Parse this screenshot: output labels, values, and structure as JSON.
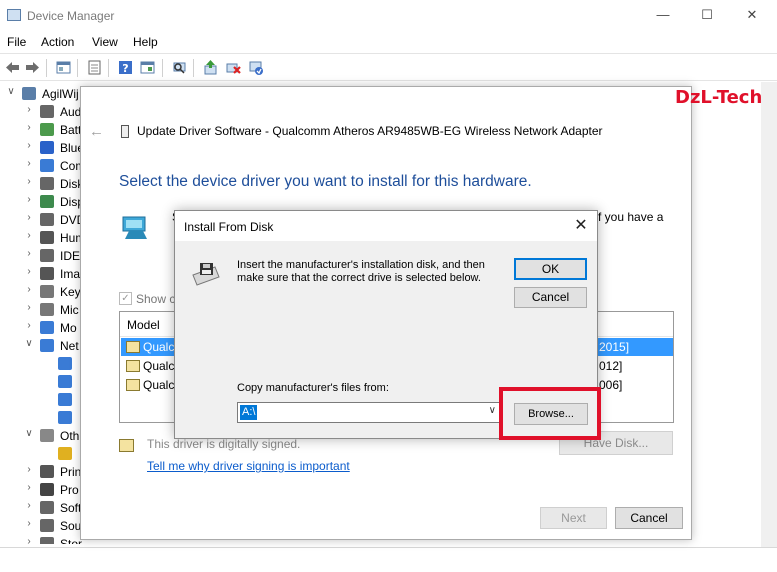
{
  "window": {
    "title": "Device Manager",
    "minimize_glyph": "—",
    "maximize_glyph": "☐",
    "close_glyph": "✕"
  },
  "menu": [
    "File",
    "Action",
    "View",
    "Help"
  ],
  "tree": [
    {
      "label": "AgilWij",
      "expander": "∨",
      "icon": "computer-icon",
      "color": "#5a7ea8"
    },
    {
      "label": "Aud",
      "expander": "›",
      "icon": "speaker-icon",
      "color": "#666666"
    },
    {
      "label": "Batt",
      "expander": "›",
      "icon": "battery-icon",
      "color": "#4c9a4c"
    },
    {
      "label": "Blue",
      "expander": "›",
      "icon": "bluetooth-icon",
      "color": "#2a62c9"
    },
    {
      "label": "Com",
      "expander": "›",
      "icon": "computer-icon",
      "color": "#3a7bd5"
    },
    {
      "label": "Disk",
      "expander": "›",
      "icon": "disk-drive-icon",
      "color": "#666666"
    },
    {
      "label": "Disp",
      "expander": "›",
      "icon": "display-adapter-icon",
      "color": "#3d8a4d"
    },
    {
      "label": "DVD",
      "expander": "›",
      "icon": "dvd-icon",
      "color": "#666666"
    },
    {
      "label": "Hum",
      "expander": "›",
      "icon": "hid-icon",
      "color": "#555555"
    },
    {
      "label": "IDE",
      "expander": "›",
      "icon": "ide-icon",
      "color": "#666666"
    },
    {
      "label": "Ima",
      "expander": "›",
      "icon": "camera-icon",
      "color": "#555555"
    },
    {
      "label": "Key",
      "expander": "›",
      "icon": "keyboard-icon",
      "color": "#777777"
    },
    {
      "label": "Mic",
      "expander": "›",
      "icon": "mouse-icon",
      "color": "#777777"
    },
    {
      "label": "Mo",
      "expander": "›",
      "icon": "monitor-icon",
      "color": "#3a7bd5"
    },
    {
      "label": "Net",
      "expander": "∨",
      "icon": "network-adapter-icon",
      "color": "#3a7bd5"
    },
    {
      "label": "",
      "expander": "",
      "icon": "network-adapter-icon",
      "color": "#3a7bd5"
    },
    {
      "label": "",
      "expander": "",
      "icon": "network-adapter-icon",
      "color": "#3a7bd5"
    },
    {
      "label": "",
      "expander": "",
      "icon": "network-adapter-icon",
      "color": "#3a7bd5"
    },
    {
      "label": "",
      "expander": "",
      "icon": "network-adapter-icon",
      "color": "#3a7bd5"
    },
    {
      "label": "Oth",
      "expander": "∨",
      "icon": "unknown-device-icon",
      "color": "#888888"
    },
    {
      "label": "",
      "expander": "",
      "icon": "warning-device-icon",
      "color": "#e0b020"
    },
    {
      "label": "Prin",
      "expander": "›",
      "icon": "printer-icon",
      "color": "#555555"
    },
    {
      "label": "Pro",
      "expander": "›",
      "icon": "processor-icon",
      "color": "#444444"
    },
    {
      "label": "Soft",
      "expander": "›",
      "icon": "software-device-icon",
      "color": "#666666"
    },
    {
      "label": "Sou",
      "expander": "›",
      "icon": "sound-icon",
      "color": "#666666"
    },
    {
      "label": "Storage controllers",
      "expander": "›",
      "icon": "storage-icon",
      "color": "#666666"
    }
  ],
  "wizard": {
    "back_glyph": "←",
    "title": "Update Driver Software - Qualcomm Atheros AR9485WB-EG Wireless Network Adapter",
    "heading": "Select the device driver you want to install for this hardware.",
    "side_text_left": "S",
    "side_text_right": "f you have a",
    "show_compatible_label": "Show co",
    "model_header": "Model",
    "models": [
      {
        "name": "Qualc",
        "date": "2015]",
        "selected": true
      },
      {
        "name": "Qualc",
        "date": "012]",
        "selected": false
      },
      {
        "name": "Qualc",
        "date": "006]",
        "selected": false
      }
    ],
    "signed_text": "This driver is digitally signed.",
    "signing_link": "Tell me why driver signing is important",
    "have_disk_label": "Have Disk...",
    "next_label": "Next",
    "cancel_label": "Cancel"
  },
  "install_from_disk": {
    "title": "Install From Disk",
    "close_glyph": "✕",
    "message": "Insert the manufacturer's installation disk, and then make sure that the correct drive is selected below.",
    "ok_label": "OK",
    "cancel_label": "Cancel",
    "copy_from_label": "Copy manufacturer's files from:",
    "copy_from_value": "A:\\",
    "combo_arrow": "∨",
    "browse_label": "Browse..."
  },
  "watermark": "DzL-Tech",
  "colors": {
    "highlight": "#e0102a",
    "accent": "#0078d7",
    "heading": "#1e4e9a",
    "link": "#0b5ccc",
    "selection": "#3399ff"
  }
}
